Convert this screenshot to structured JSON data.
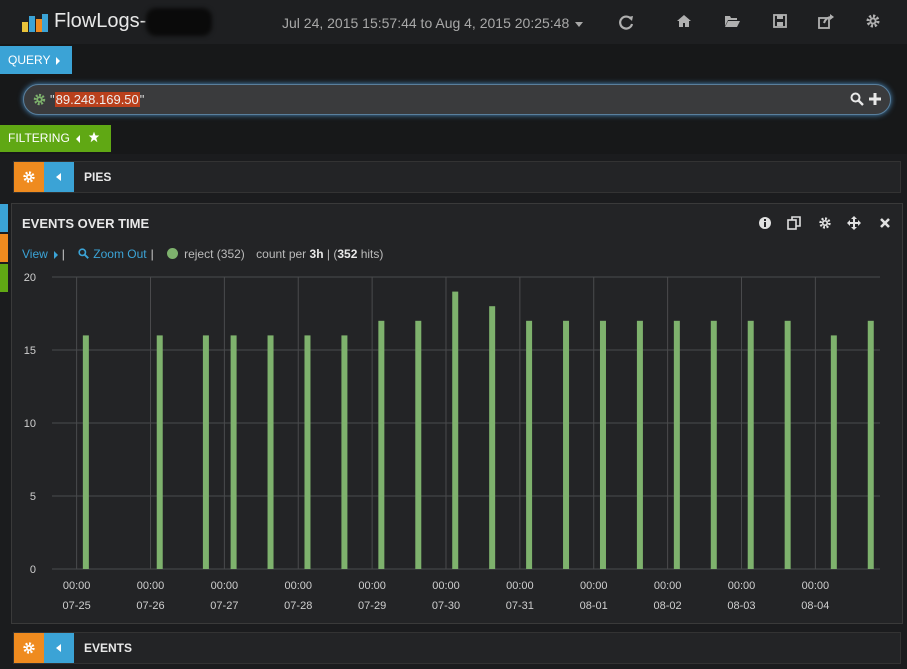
{
  "navbar": {
    "title": "FlowLogs-",
    "time_range": "Jul 24, 2015 15:57:44 to Aug 4, 2015 20:25:48",
    "icons": [
      "refresh-icon",
      "home-icon",
      "folder-open-icon",
      "save-icon",
      "share-icon",
      "gear-icon"
    ]
  },
  "query": {
    "tab_label": "QUERY",
    "quote_open": "\"",
    "value": "89.248.169.50",
    "quote_close": "\""
  },
  "filtering": {
    "tab_label": "FILTERING"
  },
  "rows": {
    "pies": {
      "title": "PIES"
    },
    "events": {
      "title": "EVENTS"
    }
  },
  "panel": {
    "title": "EVENTS OVER TIME",
    "view_label": "View",
    "zoom_label": "Zoom Out",
    "legend_label": "reject (352)",
    "count_prefix": "count per",
    "interval": "3h",
    "pipe_open": "| (",
    "hits": "352",
    "hits_suffix": "hits)"
  },
  "colors": {
    "accent_blue": "#3ba3d6",
    "accent_orange": "#ef8b1f",
    "accent_green": "#60a814",
    "series_green": "#7eb26d",
    "highlight_red": "#b9401c"
  },
  "chart_data": {
    "type": "bar",
    "title": "EVENTS OVER TIME",
    "series": [
      {
        "name": "reject (352)",
        "points": [
          [
            "07-25 03:00",
            16
          ],
          [
            "07-26 03:00",
            16
          ],
          [
            "07-26 18:00",
            16
          ],
          [
            "07-27 03:00",
            16
          ],
          [
            "07-27 15:00",
            16
          ],
          [
            "07-28 03:00",
            16
          ],
          [
            "07-28 15:00",
            16
          ],
          [
            "07-29 03:00",
            17
          ],
          [
            "07-29 15:00",
            17
          ],
          [
            "07-30 03:00",
            19
          ],
          [
            "07-30 15:00",
            18
          ],
          [
            "07-31 03:00",
            17
          ],
          [
            "07-31 15:00",
            17
          ],
          [
            "08-01 03:00",
            17
          ],
          [
            "08-01 15:00",
            17
          ],
          [
            "08-02 03:00",
            17
          ],
          [
            "08-02 15:00",
            17
          ],
          [
            "08-03 03:00",
            17
          ],
          [
            "08-03 15:00",
            17
          ],
          [
            "08-04 06:00",
            16
          ],
          [
            "08-04 18:00",
            17
          ]
        ]
      }
    ],
    "y_ticks": [
      "0",
      "5",
      "10",
      "15",
      "20"
    ],
    "ylim": [
      0,
      20
    ],
    "x_ticks": [
      {
        "time": "00:00",
        "date": "07-25"
      },
      {
        "time": "00:00",
        "date": "07-26"
      },
      {
        "time": "00:00",
        "date": "07-27"
      },
      {
        "time": "00:00",
        "date": "07-28"
      },
      {
        "time": "00:00",
        "date": "07-29"
      },
      {
        "time": "00:00",
        "date": "07-30"
      },
      {
        "time": "00:00",
        "date": "07-31"
      },
      {
        "time": "00:00",
        "date": "08-01"
      },
      {
        "time": "00:00",
        "date": "08-02"
      },
      {
        "time": "00:00",
        "date": "08-03"
      },
      {
        "time": "00:00",
        "date": "08-04"
      }
    ],
    "xlim": [
      "07-24 16:00",
      "08-04 21:00"
    ],
    "grid": true
  }
}
